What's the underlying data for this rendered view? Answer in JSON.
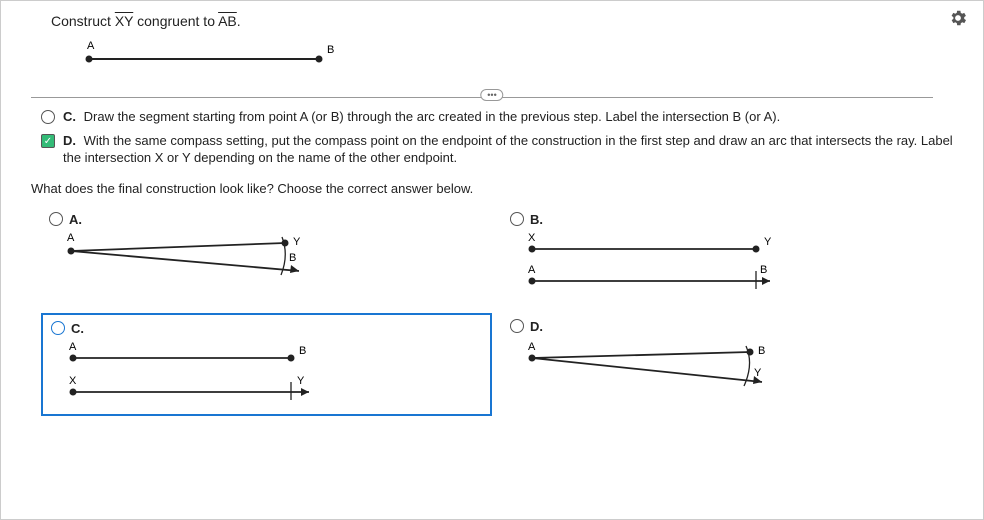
{
  "title_prefix": "Construct ",
  "title_seg1": "XY",
  "title_mid": " congruent to ",
  "title_seg2": "AB",
  "title_suffix": ".",
  "segment_A": "A",
  "segment_B": "B",
  "collapse_label": "•••",
  "step_c_letter": "C.",
  "step_c_text": "Draw the segment starting from point A (or B) through the arc created in the previous step. Label the intersection B (or A).",
  "step_d_letter": "D.",
  "step_d_text": "With the same compass setting, put the compass point on the endpoint of the construction in the first step and draw an arc that intersects the ray. Label the intersection X or Y depending on the name of the other endpoint.",
  "sub_question": "What does the final construction look like? Choose the correct answer below.",
  "choices": {
    "a": {
      "letter": "A.",
      "labels": {
        "A": "A",
        "B": "B",
        "Y": "Y"
      }
    },
    "b": {
      "letter": "B.",
      "labels": {
        "X": "X",
        "Y": "Y",
        "A": "A",
        "B": "B"
      }
    },
    "c": {
      "letter": "C.",
      "labels": {
        "A": "A",
        "B": "B",
        "X": "X",
        "Y": "Y"
      }
    },
    "d": {
      "letter": "D.",
      "labels": {
        "A": "A",
        "B": "B",
        "Y": "Y"
      }
    }
  }
}
